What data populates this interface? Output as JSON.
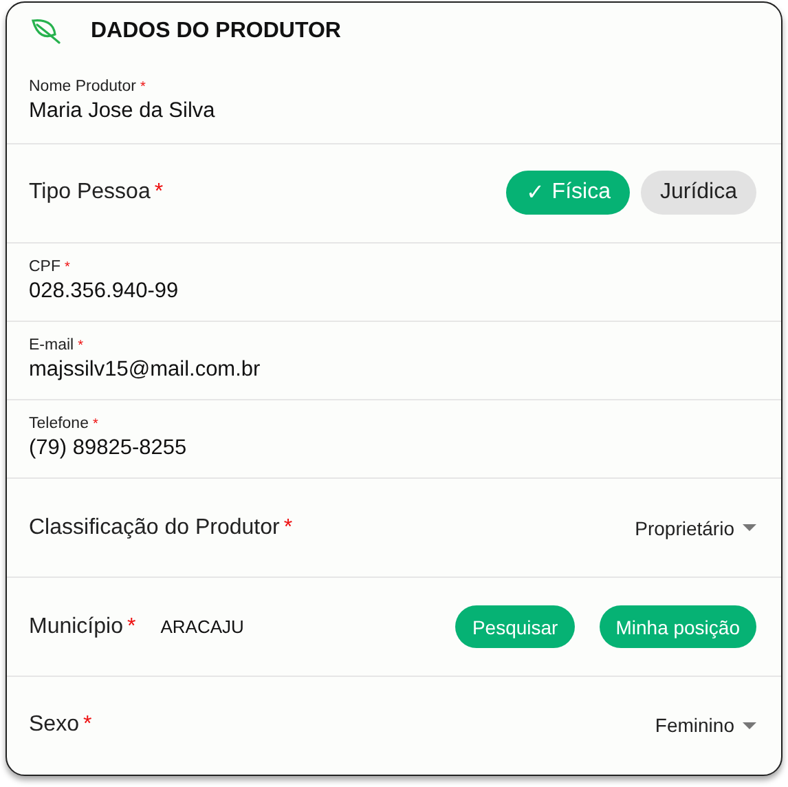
{
  "header": {
    "title": "DADOS DO PRODUTOR"
  },
  "fields": [
    {
      "kind": "text",
      "label": "Nome Produtor",
      "required_mark": "*",
      "value": "Maria Jose da Silva"
    },
    {
      "kind": "choice",
      "label": "Tipo Pessoa",
      "required_mark": "*",
      "options": [
        {
          "label": "Física",
          "check": "✓",
          "selected": true
        },
        {
          "label": "Jurídica",
          "selected": false
        }
      ]
    },
    {
      "kind": "text",
      "label": "CPF",
      "required_mark": "*",
      "value": "028.356.940-99"
    },
    {
      "kind": "text",
      "label": "E-mail",
      "required_mark": "*",
      "value": "majssilv15@mail.com.br"
    },
    {
      "kind": "text",
      "label": "Telefone",
      "required_mark": "*",
      "value": "(79) 89825-8255"
    },
    {
      "kind": "select",
      "label": "Classificação do Produtor",
      "required_mark": "*",
      "value": "Proprietário"
    },
    {
      "kind": "city",
      "label": "Município",
      "required_mark": "*",
      "value": "ARACAJU",
      "buttons": [
        "Pesquisar",
        "Minha posição"
      ]
    },
    {
      "kind": "select",
      "label": "Sexo",
      "required_mark": "*",
      "value": "Feminino"
    }
  ]
}
